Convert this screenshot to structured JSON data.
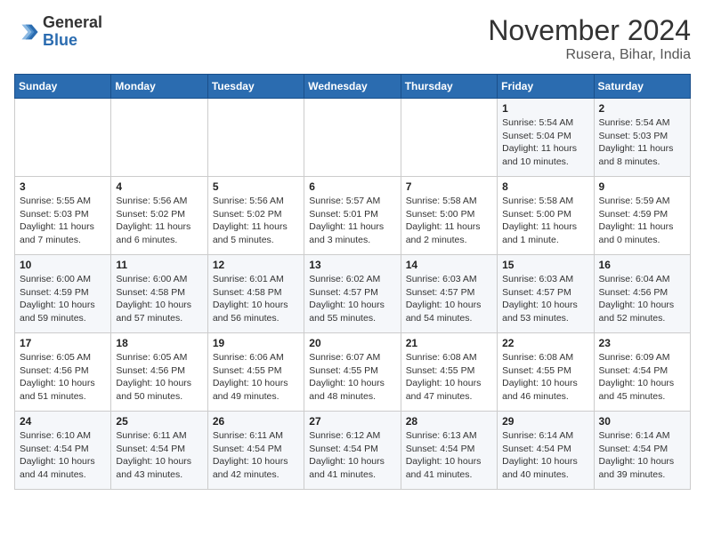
{
  "header": {
    "logo_line1": "General",
    "logo_line2": "Blue",
    "month": "November 2024",
    "location": "Rusera, Bihar, India"
  },
  "weekdays": [
    "Sunday",
    "Monday",
    "Tuesday",
    "Wednesday",
    "Thursday",
    "Friday",
    "Saturday"
  ],
  "weeks": [
    [
      {
        "day": "",
        "info": ""
      },
      {
        "day": "",
        "info": ""
      },
      {
        "day": "",
        "info": ""
      },
      {
        "day": "",
        "info": ""
      },
      {
        "day": "",
        "info": ""
      },
      {
        "day": "1",
        "info": "Sunrise: 5:54 AM\nSunset: 5:04 PM\nDaylight: 11 hours\nand 10 minutes."
      },
      {
        "day": "2",
        "info": "Sunrise: 5:54 AM\nSunset: 5:03 PM\nDaylight: 11 hours\nand 8 minutes."
      }
    ],
    [
      {
        "day": "3",
        "info": "Sunrise: 5:55 AM\nSunset: 5:03 PM\nDaylight: 11 hours\nand 7 minutes."
      },
      {
        "day": "4",
        "info": "Sunrise: 5:56 AM\nSunset: 5:02 PM\nDaylight: 11 hours\nand 6 minutes."
      },
      {
        "day": "5",
        "info": "Sunrise: 5:56 AM\nSunset: 5:02 PM\nDaylight: 11 hours\nand 5 minutes."
      },
      {
        "day": "6",
        "info": "Sunrise: 5:57 AM\nSunset: 5:01 PM\nDaylight: 11 hours\nand 3 minutes."
      },
      {
        "day": "7",
        "info": "Sunrise: 5:58 AM\nSunset: 5:00 PM\nDaylight: 11 hours\nand 2 minutes."
      },
      {
        "day": "8",
        "info": "Sunrise: 5:58 AM\nSunset: 5:00 PM\nDaylight: 11 hours\nand 1 minute."
      },
      {
        "day": "9",
        "info": "Sunrise: 5:59 AM\nSunset: 4:59 PM\nDaylight: 11 hours\nand 0 minutes."
      }
    ],
    [
      {
        "day": "10",
        "info": "Sunrise: 6:00 AM\nSunset: 4:59 PM\nDaylight: 10 hours\nand 59 minutes."
      },
      {
        "day": "11",
        "info": "Sunrise: 6:00 AM\nSunset: 4:58 PM\nDaylight: 10 hours\nand 57 minutes."
      },
      {
        "day": "12",
        "info": "Sunrise: 6:01 AM\nSunset: 4:58 PM\nDaylight: 10 hours\nand 56 minutes."
      },
      {
        "day": "13",
        "info": "Sunrise: 6:02 AM\nSunset: 4:57 PM\nDaylight: 10 hours\nand 55 minutes."
      },
      {
        "day": "14",
        "info": "Sunrise: 6:03 AM\nSunset: 4:57 PM\nDaylight: 10 hours\nand 54 minutes."
      },
      {
        "day": "15",
        "info": "Sunrise: 6:03 AM\nSunset: 4:57 PM\nDaylight: 10 hours\nand 53 minutes."
      },
      {
        "day": "16",
        "info": "Sunrise: 6:04 AM\nSunset: 4:56 PM\nDaylight: 10 hours\nand 52 minutes."
      }
    ],
    [
      {
        "day": "17",
        "info": "Sunrise: 6:05 AM\nSunset: 4:56 PM\nDaylight: 10 hours\nand 51 minutes."
      },
      {
        "day": "18",
        "info": "Sunrise: 6:05 AM\nSunset: 4:56 PM\nDaylight: 10 hours\nand 50 minutes."
      },
      {
        "day": "19",
        "info": "Sunrise: 6:06 AM\nSunset: 4:55 PM\nDaylight: 10 hours\nand 49 minutes."
      },
      {
        "day": "20",
        "info": "Sunrise: 6:07 AM\nSunset: 4:55 PM\nDaylight: 10 hours\nand 48 minutes."
      },
      {
        "day": "21",
        "info": "Sunrise: 6:08 AM\nSunset: 4:55 PM\nDaylight: 10 hours\nand 47 minutes."
      },
      {
        "day": "22",
        "info": "Sunrise: 6:08 AM\nSunset: 4:55 PM\nDaylight: 10 hours\nand 46 minutes."
      },
      {
        "day": "23",
        "info": "Sunrise: 6:09 AM\nSunset: 4:54 PM\nDaylight: 10 hours\nand 45 minutes."
      }
    ],
    [
      {
        "day": "24",
        "info": "Sunrise: 6:10 AM\nSunset: 4:54 PM\nDaylight: 10 hours\nand 44 minutes."
      },
      {
        "day": "25",
        "info": "Sunrise: 6:11 AM\nSunset: 4:54 PM\nDaylight: 10 hours\nand 43 minutes."
      },
      {
        "day": "26",
        "info": "Sunrise: 6:11 AM\nSunset: 4:54 PM\nDaylight: 10 hours\nand 42 minutes."
      },
      {
        "day": "27",
        "info": "Sunrise: 6:12 AM\nSunset: 4:54 PM\nDaylight: 10 hours\nand 41 minutes."
      },
      {
        "day": "28",
        "info": "Sunrise: 6:13 AM\nSunset: 4:54 PM\nDaylight: 10 hours\nand 41 minutes."
      },
      {
        "day": "29",
        "info": "Sunrise: 6:14 AM\nSunset: 4:54 PM\nDaylight: 10 hours\nand 40 minutes."
      },
      {
        "day": "30",
        "info": "Sunrise: 6:14 AM\nSunset: 4:54 PM\nDaylight: 10 hours\nand 39 minutes."
      }
    ]
  ]
}
